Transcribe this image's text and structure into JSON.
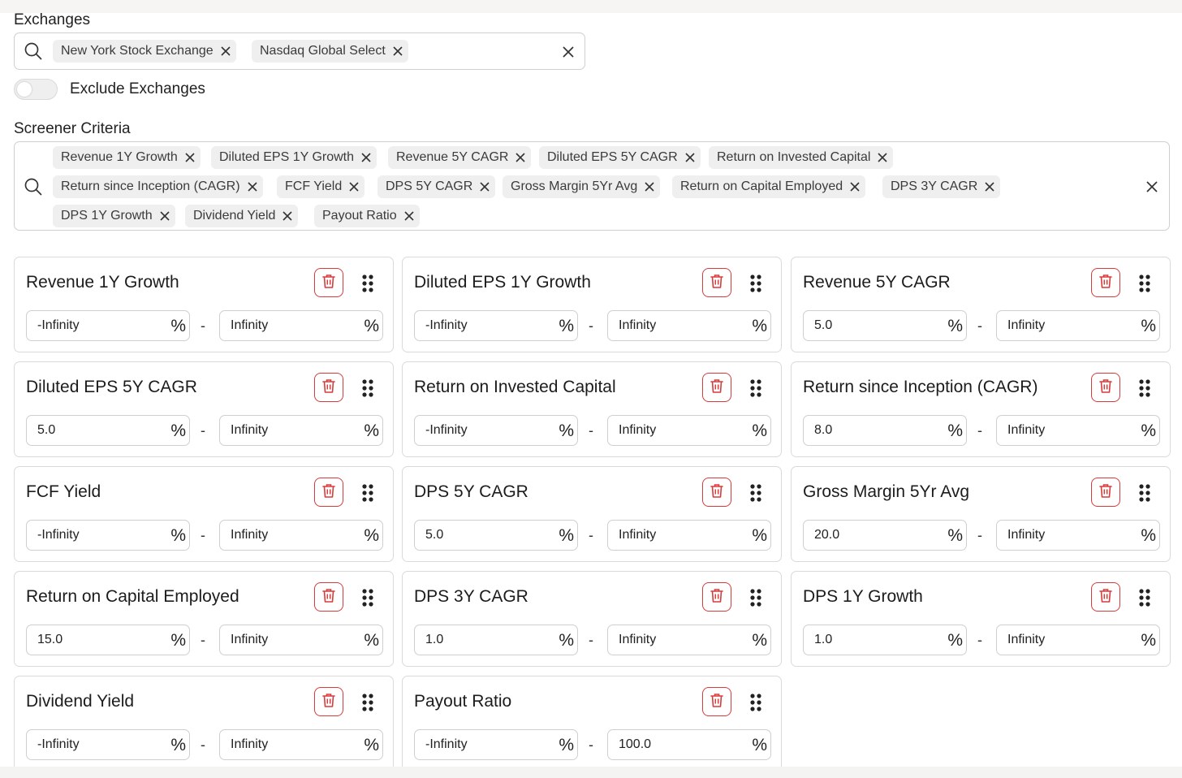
{
  "exchanges": {
    "label": "Exchanges",
    "chips": [
      "New York Stock Exchange",
      "Nasdaq Global Select"
    ]
  },
  "exclude_toggle": {
    "label": "Exclude Exchanges",
    "on": false
  },
  "criteria": {
    "label": "Screener Criteria",
    "chips": [
      "Revenue 1Y Growth",
      "Diluted EPS 1Y Growth",
      "Revenue 5Y CAGR",
      "Diluted EPS 5Y CAGR",
      "Return on Invested Capital",
      "Return since Inception (CAGR)",
      "FCF Yield",
      "DPS 5Y CAGR",
      "Gross Margin 5Yr Avg",
      "Return on Capital Employed",
      "DPS 3Y CAGR",
      "DPS 1Y Growth",
      "Dividend Yield",
      "Payout Ratio"
    ]
  },
  "cards": [
    {
      "title": "Revenue 1Y Growth",
      "min": "-Infinity",
      "max": "Infinity",
      "unit": "%"
    },
    {
      "title": "Diluted EPS 1Y Growth",
      "min": "-Infinity",
      "max": "Infinity",
      "unit": "%"
    },
    {
      "title": "Revenue 5Y CAGR",
      "min": "5.0",
      "max": "Infinity",
      "unit": "%"
    },
    {
      "title": "Diluted EPS 5Y CAGR",
      "min": "5.0",
      "max": "Infinity",
      "unit": "%"
    },
    {
      "title": "Return on Invested Capital",
      "min": "-Infinity",
      "max": "Infinity",
      "unit": "%"
    },
    {
      "title": "Return since Inception (CAGR)",
      "min": "8.0",
      "max": "Infinity",
      "unit": "%"
    },
    {
      "title": "FCF Yield",
      "min": "-Infinity",
      "max": "Infinity",
      "unit": "%"
    },
    {
      "title": "DPS 5Y CAGR",
      "min": "5.0",
      "max": "Infinity",
      "unit": "%"
    },
    {
      "title": "Gross Margin 5Yr Avg",
      "min": "20.0",
      "max": "Infinity",
      "unit": "%"
    },
    {
      "title": "Return on Capital Employed",
      "min": "15.0",
      "max": "Infinity",
      "unit": "%"
    },
    {
      "title": "DPS 3Y CAGR",
      "min": "1.0",
      "max": "Infinity",
      "unit": "%"
    },
    {
      "title": "DPS 1Y Growth",
      "min": "1.0",
      "max": "Infinity",
      "unit": "%"
    },
    {
      "title": "Dividend Yield",
      "min": "-Infinity",
      "max": "Infinity",
      "unit": "%"
    },
    {
      "title": "Payout Ratio",
      "min": "-Infinity",
      "max": "100.0",
      "unit": "%"
    }
  ],
  "range_separator": "-",
  "colors": {
    "delete_accent": "#d93a3a",
    "chip_bg": "#efefef",
    "border": "#cfcfcf"
  },
  "icons": {
    "search": "search-icon",
    "clear": "close-icon",
    "delete": "trash-icon",
    "drag": "drag-handle-icon"
  }
}
